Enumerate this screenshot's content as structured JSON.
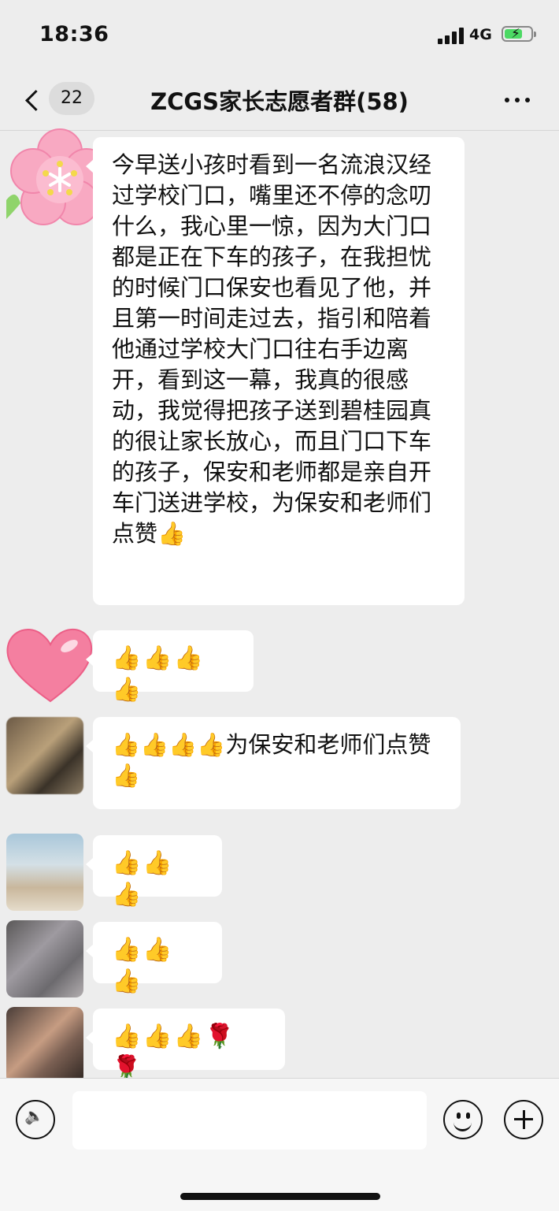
{
  "status_bar": {
    "time": "18:36",
    "network": "4G",
    "icons": [
      "signal-icon",
      "battery-charging-icon"
    ]
  },
  "nav": {
    "unread_count": "22",
    "title": "ZCGS家长志愿者群(58)",
    "icons": [
      "back-icon",
      "more-icon"
    ]
  },
  "messages": [
    {
      "avatar": "flower-sticker-avatar",
      "text": "今早送小孩时看到一名流浪汉经过学校门口，嘴里还不停的念叨什么，我心里一惊，因为大门口都是正在下车的孩子，在我担忧的时候门口保安也看见了他，并且第一时间走过去，指引和陪着他通过学校大门口往右手边离开，看到这一幕，我真的很感动，我觉得把孩子送到碧桂园真的很让家长放心，而且门口下车的孩子，保安和老师都是亲自开车门送进学校，为保安和老师们点赞👍"
    },
    {
      "avatar": "heart-sticker-avatar",
      "text": "👍👍👍👍"
    },
    {
      "avatar": "blurred-avatar",
      "text": "👍👍👍👍为保安和老师们点赞👍"
    },
    {
      "avatar": "blurred-avatar",
      "text": "👍👍👍"
    },
    {
      "avatar": "blurred-avatar",
      "text": "👍👍👍"
    },
    {
      "avatar": "blurred-avatar",
      "text": "👍👍👍🌹🌹"
    }
  ],
  "input_bar": {
    "placeholder": "",
    "icons": [
      "voice-icon",
      "emoji-icon",
      "plus-icon"
    ]
  },
  "colors": {
    "background": "#ededed",
    "bubble": "#ffffff",
    "input_bar": "#f6f6f6"
  }
}
